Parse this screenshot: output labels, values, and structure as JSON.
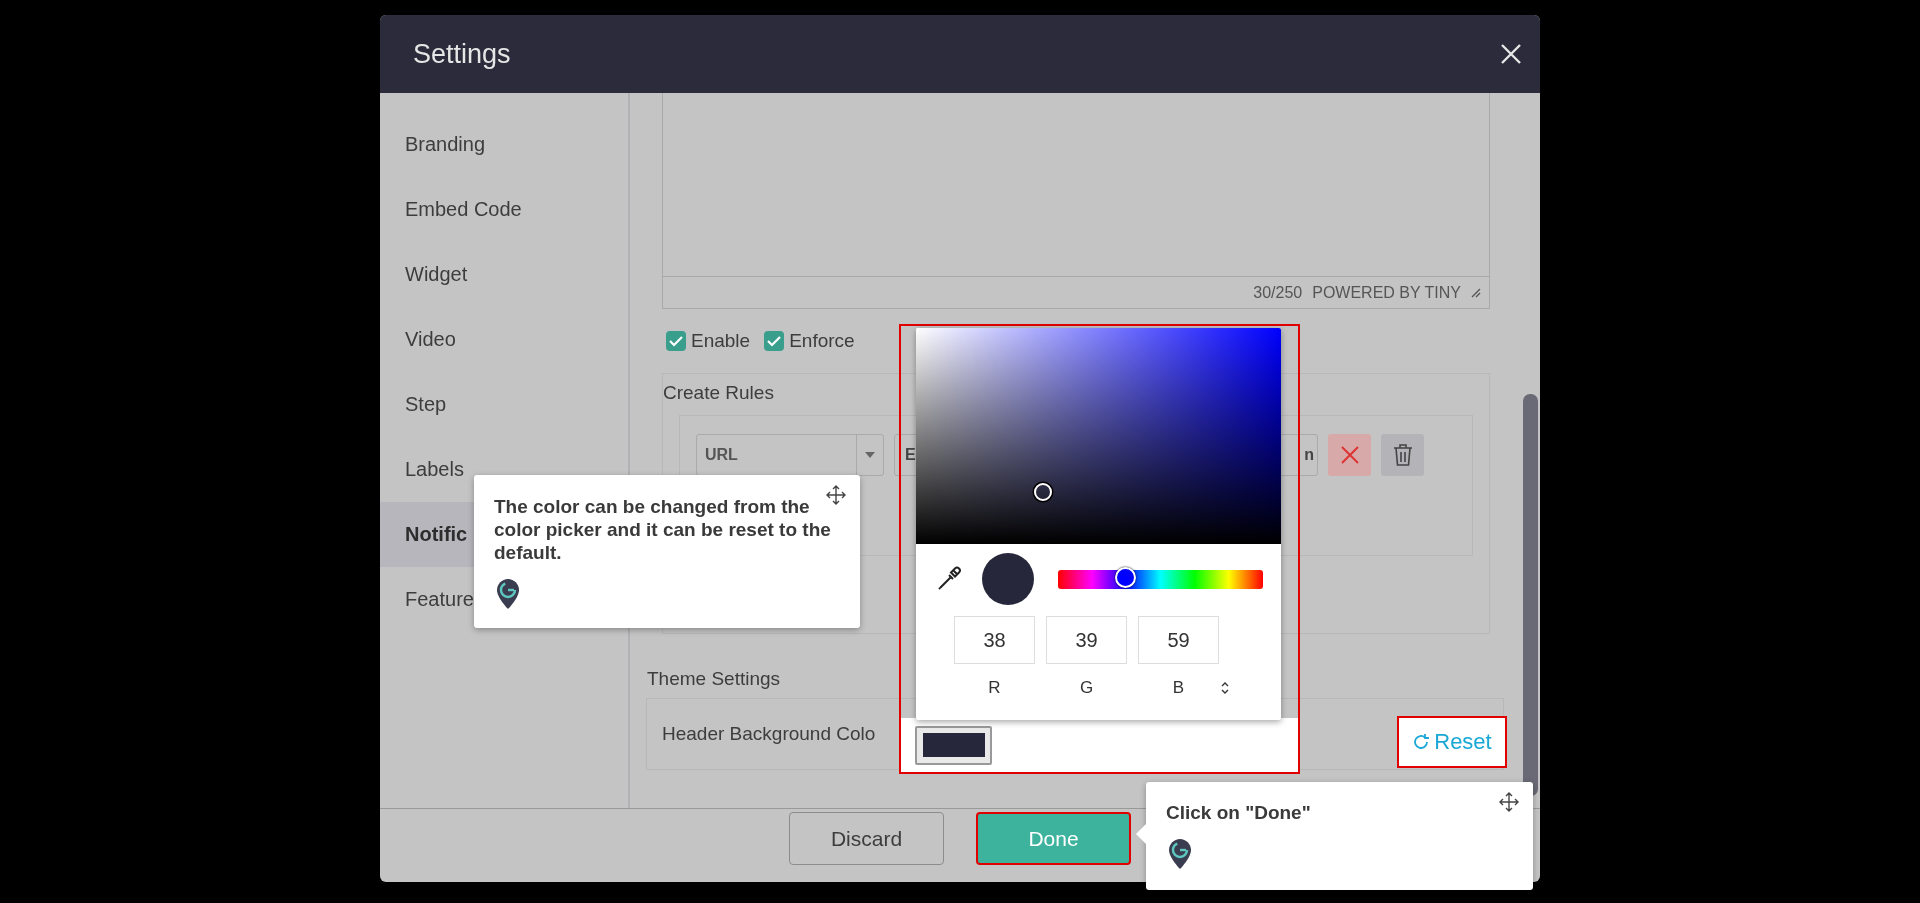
{
  "dialog": {
    "title": "Settings"
  },
  "sidebar": {
    "items": [
      {
        "label": "Branding",
        "selected": false
      },
      {
        "label": "Embed Code",
        "selected": false
      },
      {
        "label": "Widget",
        "selected": false
      },
      {
        "label": "Video",
        "selected": false
      },
      {
        "label": "Step",
        "selected": false
      },
      {
        "label": "Labels",
        "selected": false
      },
      {
        "label": "Notific",
        "selected": true
      },
      {
        "label": "Feature",
        "selected": false
      }
    ]
  },
  "editor": {
    "counter": "30/250",
    "powered_by": "POWERED BY TINY"
  },
  "options": [
    {
      "label": "Enable",
      "checked": true
    },
    {
      "label": "Enforce",
      "checked": true
    }
  ],
  "create_rules": {
    "title": "Create Rules",
    "rule": {
      "field": "URL",
      "operator": "E",
      "value": "n"
    }
  },
  "theme_settings": {
    "title": "Theme Settings",
    "header_color_label": "Header Background Colo",
    "reset": "Reset"
  },
  "color_picker": {
    "hue": {
      "level": 0.33
    },
    "channels": [
      {
        "value": "38",
        "label": "R"
      },
      {
        "value": "39",
        "label": "G"
      },
      {
        "value": "59",
        "label": "B"
      }
    ]
  },
  "buttons": [
    {
      "label": "Discard",
      "kind": "secondary"
    },
    {
      "label": "Done",
      "kind": "primary"
    }
  ],
  "tooltips": [
    {
      "text": "The color can be changed from the color picker and it can be reset to the default."
    },
    {
      "text": "Click on \"Done\""
    }
  ]
}
